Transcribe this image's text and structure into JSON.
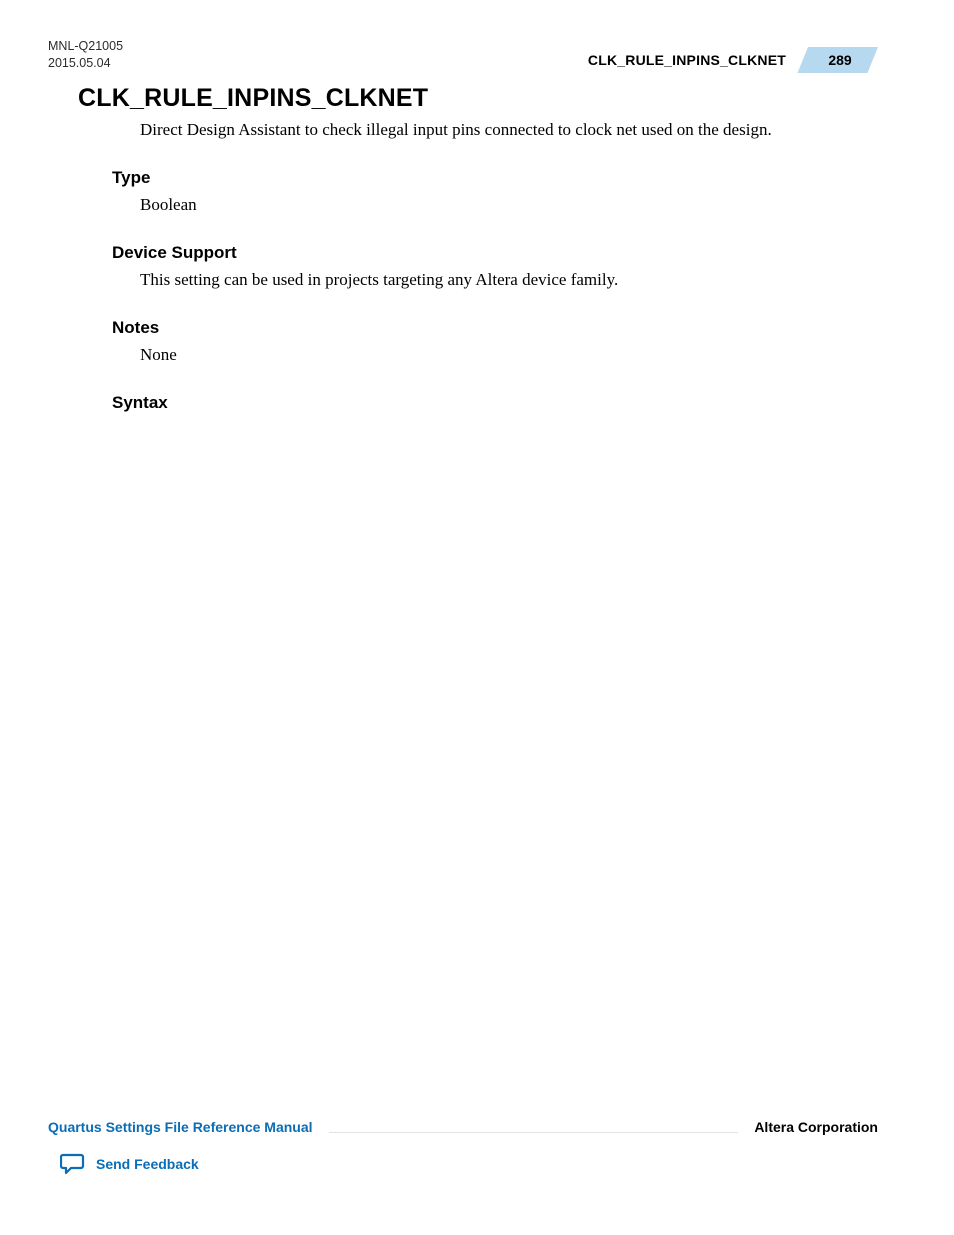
{
  "header": {
    "doc_id": "MNL-Q21005",
    "date": "2015.05.04",
    "section_title": "CLK_RULE_INPINS_CLKNET",
    "page_number": "289"
  },
  "main": {
    "heading": "CLK_RULE_INPINS_CLKNET",
    "intro": "Direct Design Assistant to check illegal input pins connected to clock net used on the design.",
    "sections": {
      "type": {
        "label": "Type",
        "body": "Boolean"
      },
      "device_support": {
        "label": "Device Support",
        "body": "This setting can be used in projects targeting any Altera device family."
      },
      "notes": {
        "label": "Notes",
        "body": "None"
      },
      "syntax": {
        "label": "Syntax",
        "body": ""
      }
    }
  },
  "footer": {
    "manual_name": "Quartus Settings File Reference Manual",
    "corporation": "Altera Corporation",
    "feedback_label": "Send Feedback"
  }
}
